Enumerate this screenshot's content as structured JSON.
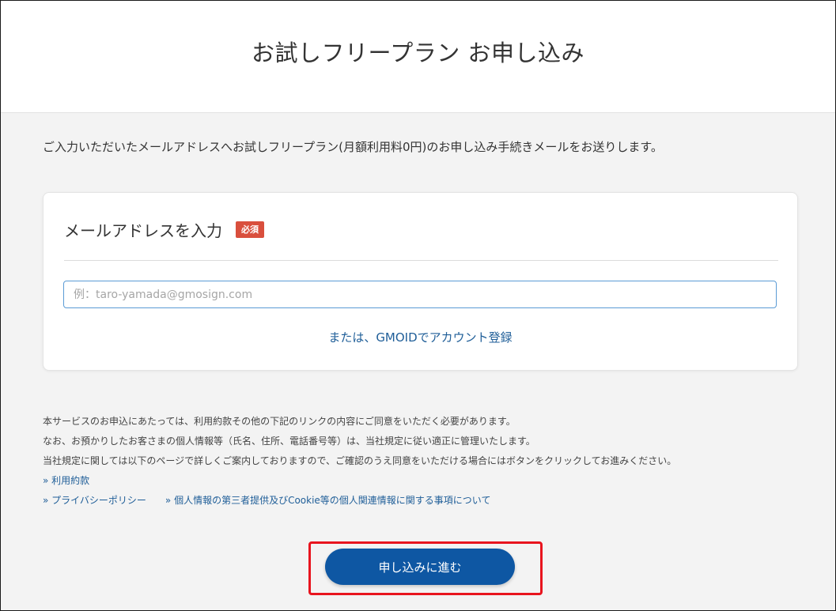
{
  "header": {
    "title": "お試しフリープラン お申し込み"
  },
  "intro": {
    "text": "ご入力いただいたメールアドレスへお試しフリープラン(月額利用料0円)のお申し込み手続きメールをお送りします。"
  },
  "form": {
    "email_label": "メールアドレスを入力",
    "required_badge": "必須",
    "email_value": "",
    "email_placeholder": "例：taro-yamada@gmosign.com",
    "gmoid_link": "または、GMOIDでアカウント登録"
  },
  "terms": {
    "line1": "本サービスのお申込にあたっては、利用約款その他の下記のリンクの内容にご同意をいただく必要があります。",
    "line2": "なお、お預かりしたお客さまの個人情報等（氏名、住所、電話番号等）は、当社規定に従い適正に管理いたします。",
    "line3": "当社規定に関しては以下のページで詳しくご案内しておりますので、ご確認のうえ同意をいただける場合にはボタンをクリックしてお進みください。",
    "link_terms": "» 利用約款",
    "link_privacy": "» プライバシーポリシー",
    "link_cookie": "» 個人情報の第三者提供及びCookie等の個人関連情報に関する事項について"
  },
  "submit": {
    "label": "申し込みに進む"
  },
  "colors": {
    "primary_button": "#0e57a3",
    "link": "#1f5e98",
    "required_badge": "#d94f3d",
    "highlight_border": "#e8141e"
  }
}
